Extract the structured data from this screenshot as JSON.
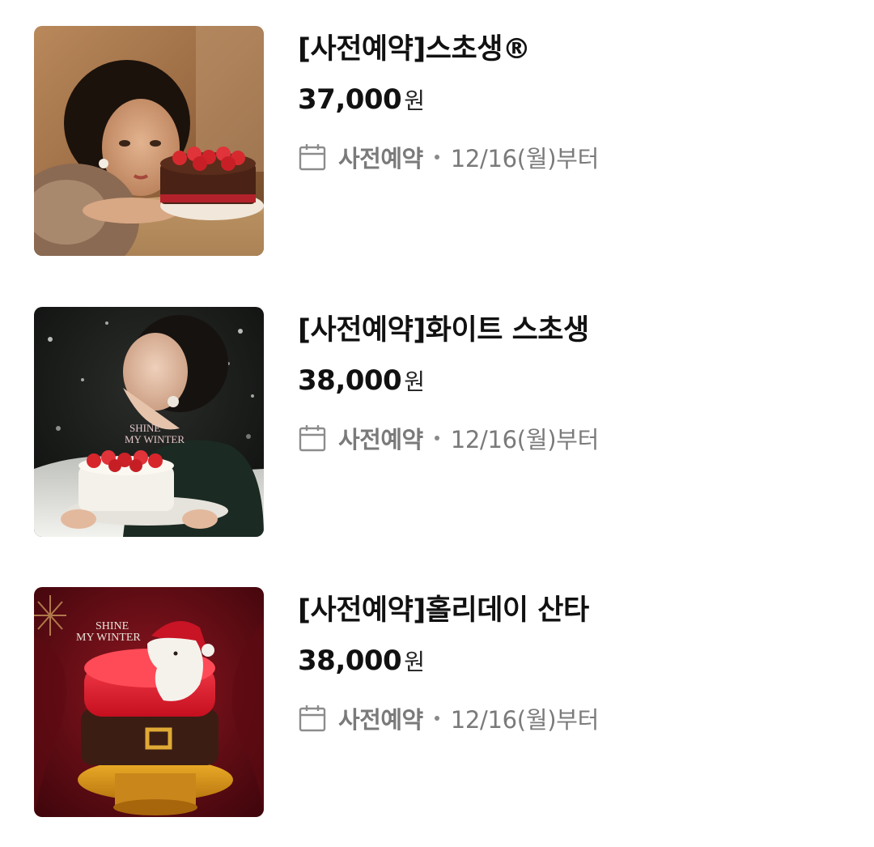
{
  "products": [
    {
      "title": "[사전예약]스초생®",
      "price": "37,000",
      "currency": "원",
      "reservation_label": "사전예약",
      "reservation_date": "12/16(월)부터",
      "image_icon": "strawberry-chocolate-cake-photo"
    },
    {
      "title": "[사전예약]화이트 스초생",
      "price": "38,000",
      "currency": "원",
      "reservation_label": "사전예약",
      "reservation_date": "12/16(월)부터",
      "image_icon": "white-strawberry-cake-photo",
      "image_text": "SHINE MY WINTER"
    },
    {
      "title": "[사전예약]홀리데이 산타",
      "price": "38,000",
      "currency": "원",
      "reservation_label": "사전예약",
      "reservation_date": "12/16(월)부터",
      "image_icon": "santa-cake-photo",
      "image_text": "SHINE MY WINTER"
    }
  ],
  "icons": {
    "calendar": "calendar-icon"
  },
  "colors": {
    "title": "#111111",
    "meta": "#7a7a7a",
    "background": "#ffffff"
  }
}
